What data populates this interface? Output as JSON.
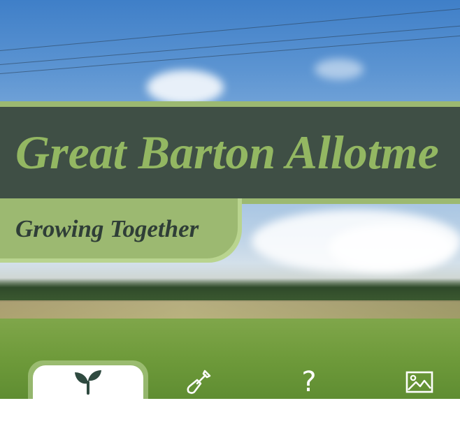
{
  "site": {
    "title": "Great Barton Allotme",
    "tagline": "Growing Together"
  },
  "nav": {
    "tabs": [
      {
        "icon": "seedling-icon",
        "active": true
      },
      {
        "icon": "shovel-icon",
        "active": false
      },
      {
        "icon": "question-mark-icon",
        "glyph": "?",
        "active": false
      },
      {
        "icon": "picture-icon",
        "active": false
      }
    ]
  },
  "colors": {
    "title_band": "#3c4b44",
    "accent_green": "#93b762",
    "tagline_text": "#2f3e37"
  }
}
